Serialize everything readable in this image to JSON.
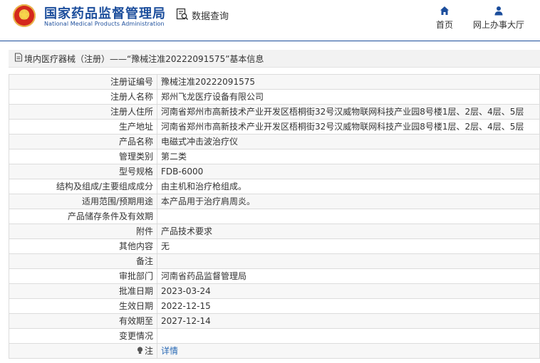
{
  "header": {
    "brand_cn": "国家药品监督管理局",
    "brand_en": "National Medical Products Administration",
    "search_label": "数据查询",
    "nav": {
      "home": "首页",
      "online_hall": "网上办事大厅"
    }
  },
  "breadcrumb": {
    "text": "境内医疗器械（注册）——“豫械注准20222091575”基本信息"
  },
  "details": [
    {
      "label": "注册证编号",
      "value": "豫械注准20222091575"
    },
    {
      "label": "注册人名称",
      "value": "郑州飞龙医疗设备有限公司"
    },
    {
      "label": "注册人住所",
      "value": "河南省郑州市高新技术产业开发区梧桐街32号汉威物联网科技产业园8号楼1层、2层、4层、5层"
    },
    {
      "label": "生产地址",
      "value": "河南省郑州市高新技术产业开发区梧桐街32号汉威物联网科技产业园8号楼1层、2层、4层、5层"
    },
    {
      "label": "产品名称",
      "value": "电磁式冲击波治疗仪"
    },
    {
      "label": "管理类别",
      "value": "第二类"
    },
    {
      "label": "型号规格",
      "value": "FDB-6000"
    },
    {
      "label": "结构及组成/主要组成成分",
      "value": "由主机和治疗枪组成。"
    },
    {
      "label": "适用范围/预期用途",
      "value": "本产品用于治疗肩周炎。"
    },
    {
      "label": "产品储存条件及有效期",
      "value": ""
    },
    {
      "label": "附件",
      "value": "产品技术要求"
    },
    {
      "label": "其他内容",
      "value": "无"
    },
    {
      "label": "备注",
      "value": ""
    },
    {
      "label": "审批部门",
      "value": "河南省药品监督管理局"
    },
    {
      "label": "批准日期",
      "value": "2023-03-24"
    },
    {
      "label": "生效日期",
      "value": "2022-12-15"
    },
    {
      "label": "有效期至",
      "value": "2027-12-14"
    },
    {
      "label": "变更情况",
      "value": ""
    }
  ],
  "note_row": {
    "label": "注",
    "link": "详情",
    "icon": "bulb-icon"
  },
  "colors": {
    "brand_blue": "#1c4e9c",
    "link_blue": "#2a6ab5"
  }
}
